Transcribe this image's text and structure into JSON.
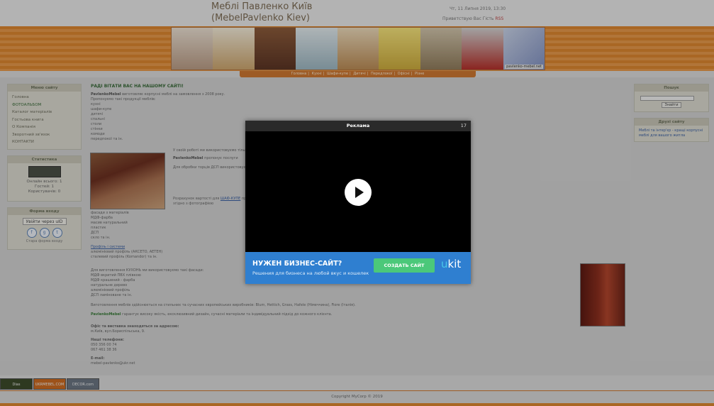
{
  "header": {
    "title_line1": "Меблі Павленко Київ",
    "title_line2": "(MebelPavlenko Kiev)",
    "date": "Чт, 11 Липня 2019, 13:30",
    "greeting": "Приветствую Вас Гість",
    "greeting_link": "RSS",
    "banner_caption": "pavlenko-mebel.net"
  },
  "nav": [
    "Головна",
    "Кухні",
    "Шафи-купе",
    "Дитячі",
    "Передпокої",
    "Офісні",
    "Різне"
  ],
  "sidebar_left": {
    "menu_title": "Меню сайту",
    "menu_items": [
      "Головна",
      "ФОТОАЛЬБОМ",
      "Каталог матеріалів",
      "Гостьова книга",
      "О Компанія",
      "Зворотний зв'язок",
      "КОНТАКТИ"
    ],
    "stats_title": "Статистика",
    "stats_lines": [
      "Онлайн всього: 1",
      "Гостей: 1",
      "Користувачів: 0"
    ],
    "login_title": "Форма входу",
    "login_button": "Увійти через uID",
    "social": [
      "f",
      "g",
      "t"
    ],
    "login_old": "Стара форма входу"
  },
  "sidebar_right": {
    "search_title": "Пошук",
    "search_button": "Знайти",
    "friends_title": "Друзі сайту",
    "friends_link": "Меблі та інтер'єр - кращі корпусні меблі для вашого житла"
  },
  "main": {
    "title": "РАДІ ВІТАТИ ВАС НА НАШОМУ САЙТІ!",
    "intro_brand": "PavlenkoMebel",
    "intro_text": " виготовляє корпусні меблі на замовлення з 2008 року.",
    "offer_head": "Пропонуємо такі продукції меблів:",
    "offer_items": [
      "кухні",
      "шафи-купе",
      "дитячі",
      "спальні",
      "столи",
      "стінки",
      "комоди",
      "передпокої та ін."
    ],
    "p1": "У своїй роботі ми використовуємо тільки якісні матеріали, фурнітуру і комплектуючі від провідних виробників, що мають сертифікати.",
    "p2_brand": "PavlenkoMebel",
    "p2": " пропонує послуги",
    "p3": "Для обробки торців ДСП використовуємо",
    "p4": "Розрахунок вартості для",
    "p4_link": "ШАФ-КУПЕ",
    "p4_rest": " проводиться",
    "p5": "згідно з фотографією",
    "list2": [
      "фасади з матеріалів",
      "МДФ-фарба",
      "масив натуральний",
      "пластик",
      "ДСП",
      "скло та ін."
    ],
    "p6_link": "Профіль і системи",
    "list3": [
      "алюмінієвий профіль (АКСЕТО, АЕТЕН)",
      "сталевий профіль (Komandor) та ін."
    ],
    "p7": "Для виготовлення КУХОНЬ ми використовуємо такі фасади:",
    "list4": [
      "МДФ вкритий ПВХ плівкою",
      "МДФ крашений - фарба",
      "натуральне дерево",
      "алюмінієвий профіль",
      "ДСП ламіноване та ін."
    ],
    "p8": "Виготовлення меблів здійснюється на стильних та сучасних європейських виробників: Blum, Hettich, Grass, Hafele (Німеччина), Fiore (Італія).",
    "p9_brand": "PavlenkoMebel",
    "p9": " гарантує високу якість, ексклюзивний дизайн, сучасні матеріали та індивідуальний підхід до кожного клієнта.",
    "office_head": "Офіс та виставка знаходяться за адресою:",
    "office_addr": "м.Київ, вул.Бориспільська, 9.",
    "phones_head": "Наші телефони:",
    "phones": [
      "050 356 00 74",
      "067 461 38 36"
    ],
    "email_head": "E-mail:",
    "email": "mebel-pavlenko@ukr.net"
  },
  "footer": {
    "badges": [
      "Dias",
      "UKRMEBEL.COM",
      "DECOR.com"
    ],
    "copyright": "Copyright MyCorp © 2019"
  },
  "ad": {
    "header": "Реклама",
    "counter": "17",
    "promo_title": "НУЖЕН БИЗНЕС-САЙТ?",
    "promo_sub": "Решения для бизнеса на любой вкус и кошелек",
    "promo_button": "СОЗДАТЬ САЙТ",
    "logo": "ukit"
  },
  "colors": {
    "accent_orange": "#d9852f",
    "promo_blue": "#2f7fd0",
    "promo_green": "#4bc87a"
  }
}
